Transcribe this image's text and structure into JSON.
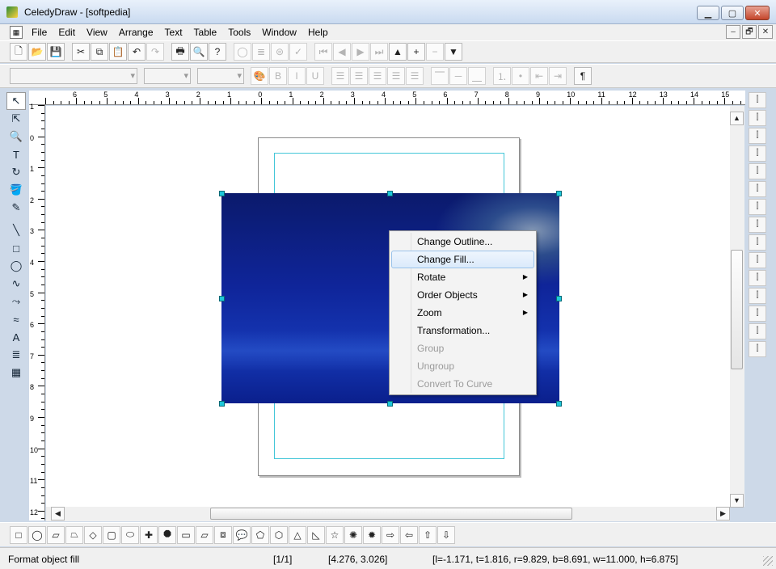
{
  "window": {
    "title": "CeledyDraw - [softpedia]",
    "min": "▁",
    "max": "▢",
    "close": "✕"
  },
  "menu": {
    "items": [
      "File",
      "Edit",
      "View",
      "Arrange",
      "Text",
      "Table",
      "Tools",
      "Window",
      "Help"
    ],
    "mdi": [
      "–",
      "🗗",
      "✕"
    ]
  },
  "toolbar1": [
    {
      "icon": "new-icon",
      "glyph": "🗋",
      "enabled": true
    },
    {
      "icon": "open-icon",
      "glyph": "📂",
      "enabled": true
    },
    {
      "icon": "save-icon",
      "glyph": "💾",
      "enabled": true
    },
    {
      "sep": true
    },
    {
      "icon": "cut-icon",
      "glyph": "✂",
      "enabled": true
    },
    {
      "icon": "copy-icon",
      "glyph": "⧉",
      "enabled": true
    },
    {
      "icon": "paste-icon",
      "glyph": "📋",
      "enabled": true
    },
    {
      "icon": "undo-icon",
      "glyph": "↶",
      "enabled": true
    },
    {
      "icon": "redo-icon",
      "glyph": "↷",
      "enabled": false
    },
    {
      "sep": true
    },
    {
      "icon": "print-icon",
      "glyph": "🖶",
      "enabled": true
    },
    {
      "icon": "print-preview-icon",
      "glyph": "🔍",
      "enabled": true
    },
    {
      "icon": "help-icon",
      "glyph": "?",
      "enabled": true
    },
    {
      "sep": true
    },
    {
      "icon": "shape-tool-icon",
      "glyph": "◯",
      "enabled": false
    },
    {
      "icon": "list-icon",
      "glyph": "≣",
      "enabled": false
    },
    {
      "icon": "stamp-icon",
      "glyph": "⊜",
      "enabled": false
    },
    {
      "icon": "spellcheck-icon",
      "glyph": "✓",
      "enabled": false
    },
    {
      "sep": true
    },
    {
      "icon": "first-page-icon",
      "glyph": "⏮",
      "enabled": false
    },
    {
      "icon": "prev-page-icon",
      "glyph": "◀",
      "enabled": false
    },
    {
      "icon": "next-page-icon",
      "glyph": "▶",
      "enabled": false
    },
    {
      "icon": "last-page-icon",
      "glyph": "⏭",
      "enabled": false
    },
    {
      "icon": "page-up-icon",
      "glyph": "▲",
      "enabled": true
    },
    {
      "icon": "add-page-icon",
      "glyph": "+",
      "enabled": true
    },
    {
      "icon": "remove-page-icon",
      "glyph": "−",
      "enabled": false
    },
    {
      "icon": "page-down-icon",
      "glyph": "▼",
      "enabled": true
    }
  ],
  "toolbar2": [
    {
      "icon": "text-color-icon",
      "glyph": "🎨",
      "enabled": false
    },
    {
      "icon": "bold-icon",
      "glyph": "B",
      "enabled": false
    },
    {
      "icon": "italic-icon",
      "glyph": "I",
      "enabled": false
    },
    {
      "icon": "underline-icon",
      "glyph": "U",
      "enabled": false
    },
    {
      "sep": true
    },
    {
      "icon": "align-left-icon",
      "glyph": "☰",
      "enabled": false
    },
    {
      "icon": "align-center-icon",
      "glyph": "☰",
      "enabled": false
    },
    {
      "icon": "align-right-icon",
      "glyph": "☰",
      "enabled": false
    },
    {
      "icon": "justify-icon",
      "glyph": "☰",
      "enabled": false
    },
    {
      "icon": "justify-all-icon",
      "glyph": "☰",
      "enabled": false
    },
    {
      "sep": true
    },
    {
      "icon": "valign-top-icon",
      "glyph": "⎺",
      "enabled": false
    },
    {
      "icon": "valign-middle-icon",
      "glyph": "─",
      "enabled": false
    },
    {
      "icon": "valign-bottom-icon",
      "glyph": "⎽",
      "enabled": false
    },
    {
      "sep": true
    },
    {
      "icon": "numbered-list-icon",
      "glyph": "⒈",
      "enabled": false
    },
    {
      "icon": "bullet-list-icon",
      "glyph": "•",
      "enabled": false
    },
    {
      "icon": "outdent-icon",
      "glyph": "⇤",
      "enabled": false
    },
    {
      "icon": "indent-icon",
      "glyph": "⇥",
      "enabled": false
    },
    {
      "sep": true
    },
    {
      "icon": "paragraph-icon",
      "glyph": "¶",
      "enabled": true
    }
  ],
  "leftTools": [
    {
      "icon": "pointer-icon",
      "glyph": "↖",
      "active": true
    },
    {
      "icon": "node-edit-icon",
      "glyph": "⇱"
    },
    {
      "icon": "zoom-icon",
      "glyph": "🔍"
    },
    {
      "icon": "text-tool-icon",
      "glyph": "T"
    },
    {
      "icon": "rotate-icon",
      "glyph": "↻"
    },
    {
      "icon": "fill-bucket-icon",
      "glyph": "🪣"
    },
    {
      "icon": "color-picker-icon",
      "glyph": "✎"
    },
    {
      "icon": "line-tool-icon",
      "glyph": "╲"
    },
    {
      "icon": "rectangle-tool-icon",
      "glyph": "□"
    },
    {
      "icon": "ellipse-tool-icon",
      "glyph": "◯"
    },
    {
      "icon": "freehand-tool-icon",
      "glyph": "∿"
    },
    {
      "icon": "bezier-tool-icon",
      "glyph": "⤳"
    },
    {
      "icon": "curve-tool-icon",
      "glyph": "≈"
    },
    {
      "icon": "artistic-text-icon",
      "glyph": "A"
    },
    {
      "icon": "paragraph-text-icon",
      "glyph": "≣"
    },
    {
      "icon": "table-tool-icon",
      "glyph": "▦"
    }
  ],
  "rightTools": [
    "align-top-edges-icon",
    "align-vcenter-icon",
    "align-bottom-edges-icon",
    "align-left-edges-icon",
    "align-hcenter-icon",
    "align-right-edges-icon",
    "distribute-top-icon",
    "distribute-vcenter-icon",
    "distribute-bottom-icon",
    "distribute-left-icon",
    "distribute-hcenter-icon",
    "distribute-right-icon",
    "space-vertical-icon",
    "space-horizontal-icon",
    "same-size-icon"
  ],
  "ruler": {
    "h": [
      "6",
      "5",
      "4",
      "3",
      "2",
      "1",
      "0",
      "1",
      "2",
      "3",
      "4",
      "5",
      "6",
      "7",
      "8",
      "9",
      "10",
      "11",
      "12",
      "13",
      "14",
      "15"
    ],
    "v": [
      "1",
      "0",
      "1",
      "2",
      "3",
      "4",
      "5",
      "6",
      "7",
      "8",
      "9",
      "10",
      "11",
      "12"
    ]
  },
  "contextMenu": [
    {
      "label": "Change Outline...",
      "enabled": true
    },
    {
      "label": "Change Fill...",
      "enabled": true,
      "highlighted": true
    },
    {
      "label": "Rotate",
      "enabled": true,
      "submenu": true
    },
    {
      "label": "Order Objects",
      "enabled": true,
      "submenu": true
    },
    {
      "label": "Zoom",
      "enabled": true,
      "submenu": true
    },
    {
      "label": "Transformation...",
      "enabled": true
    },
    {
      "label": "Group",
      "enabled": false
    },
    {
      "label": "Ungroup",
      "enabled": false
    },
    {
      "label": "Convert To Curve",
      "enabled": false
    }
  ],
  "bottomTools": [
    {
      "icon": "rectangle-shape-icon",
      "glyph": "□"
    },
    {
      "icon": "ellipse-shape-icon",
      "glyph": "◯"
    },
    {
      "icon": "parallelogram-shape-icon",
      "glyph": "▱"
    },
    {
      "icon": "trapezoid-shape-icon",
      "glyph": "⏢"
    },
    {
      "icon": "diamond-shape-icon",
      "glyph": "◇"
    },
    {
      "icon": "rounded-rect-shape-icon",
      "glyph": "▢"
    },
    {
      "icon": "oval-shape-icon",
      "glyph": "⬭"
    },
    {
      "icon": "cross-shape-icon",
      "glyph": "✚"
    },
    {
      "icon": "octagon-shape-icon",
      "glyph": "⯃"
    },
    {
      "icon": "snip-rect-shape-icon",
      "glyph": "▭"
    },
    {
      "icon": "slant-rect-shape-icon",
      "glyph": "⏥"
    },
    {
      "icon": "cube-shape-icon",
      "glyph": "⧈"
    },
    {
      "icon": "speech-bubble-shape-icon",
      "glyph": "💬"
    },
    {
      "icon": "pentagon-shape-icon",
      "glyph": "⬠"
    },
    {
      "icon": "hexagon-shape-icon",
      "glyph": "⬡"
    },
    {
      "icon": "triangle-shape-icon",
      "glyph": "△"
    },
    {
      "icon": "right-triangle-shape-icon",
      "glyph": "◺"
    },
    {
      "icon": "star-shape-icon",
      "glyph": "☆"
    },
    {
      "icon": "seal-shape-icon",
      "glyph": "✺"
    },
    {
      "icon": "burst-shape-icon",
      "glyph": "✹"
    },
    {
      "icon": "arrow-right-shape-icon",
      "glyph": "⇨"
    },
    {
      "icon": "arrow-left-shape-icon",
      "glyph": "⇦"
    },
    {
      "icon": "arrow-up-shape-icon",
      "glyph": "⇧"
    },
    {
      "icon": "arrow-down-shape-icon",
      "glyph": "⇩"
    }
  ],
  "status": {
    "hint": "Format object fill",
    "page": "[1/1]",
    "coords": "[4.276, 3.026]",
    "bounds": "[l=-1.171, t=1.816, r=9.829, b=8.691, w=11.000, h=6.875]"
  }
}
